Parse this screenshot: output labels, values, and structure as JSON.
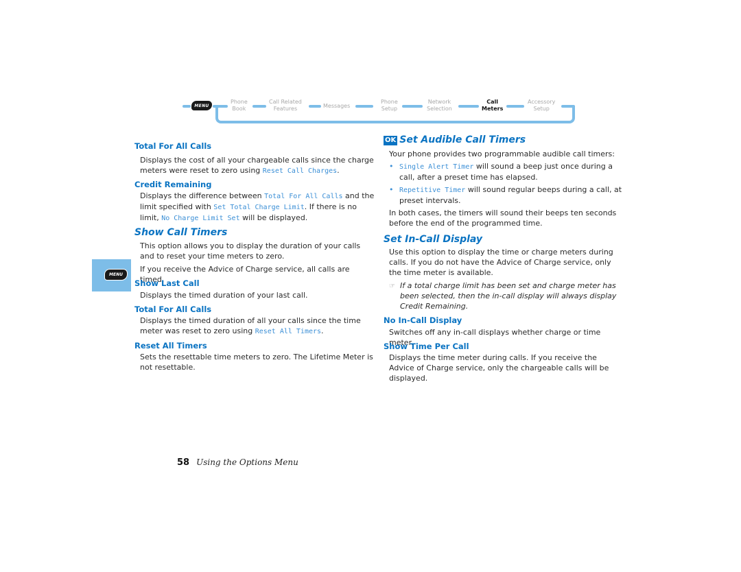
{
  "nav": {
    "menu_key": "MENU",
    "items": [
      {
        "line1": "Phone",
        "line2": "Book"
      },
      {
        "line1": "Call Related",
        "line2": "Features"
      },
      {
        "line1": "Messages",
        "line2": ""
      },
      {
        "line1": "Phone",
        "line2": "Setup"
      },
      {
        "line1": "Network",
        "line2": "Selection"
      },
      {
        "line1": "Call",
        "line2": "Meters"
      },
      {
        "line1": "Accessory",
        "line2": "Setup"
      }
    ],
    "active_index": 5
  },
  "side_tab": {
    "menu_key": "MENU"
  },
  "left": {
    "s1": {
      "heading": "Total For All Calls",
      "text_a": "Displays the cost of all your chargeable calls since the charge meters were reset to zero using ",
      "code_a": "Reset Call Charges",
      "text_b": "."
    },
    "s2": {
      "heading": "Credit Remaining",
      "text_a": "Displays the difference between ",
      "code_a": "Total For All Calls",
      "text_b": " and the limit specified with ",
      "code_b": "Set Total Charge Limit",
      "text_c": ". If there is no limit, ",
      "code_c": "No Charge Limit Set",
      "text_d": " will be displayed."
    },
    "s3": {
      "heading": "Show Call Timers",
      "p1": "This option allows you to display the duration of your calls and to reset your time meters to zero.",
      "p2": "If you receive the Advice of Charge service, all calls are timed."
    },
    "s4": {
      "heading": "Show Last Call",
      "text": "Displays the timed duration of your last call."
    },
    "s5": {
      "heading": "Total For All Calls",
      "text_a": "Displays the timed duration of all your calls since the time meter was reset to zero using ",
      "code_a": "Reset All Timers",
      "text_b": "."
    },
    "s6": {
      "heading": "Reset All Timers",
      "text": "Sets the resettable time meters to zero. The Lifetime Meter is not resettable."
    }
  },
  "right": {
    "s1": {
      "ok_icon": "OK",
      "heading": "Set Audible Call Timers",
      "intro": "Your phone provides two programmable audible call timers:",
      "bullets": [
        {
          "code": "Single Alert Timer",
          "text": " will sound a beep just once during a call, after a preset time has elapsed."
        },
        {
          "code": "Repetitive Timer",
          "text": " will sound regular beeps during a call, at preset intervals."
        }
      ],
      "outro": "In both cases, the timers will sound their beeps ten seconds before the end of the programmed time."
    },
    "s2": {
      "heading": "Set In-Call Display",
      "p1": "Use this option to display the time or charge meters during calls. If you do not have the Advice of Charge service, only the time meter is available.",
      "note": "If a total charge limit has been set and charge meter has been selected, then the in-call display will always display Credit Remaining."
    },
    "s3": {
      "heading": "No In-Call Display",
      "text": "Switches off any in-call displays whether charge or time meter."
    },
    "s4": {
      "heading": "Show Time Per Call",
      "text": "Displays the time meter during calls. If you receive the Advice of Charge service, only the chargeable calls will be displayed."
    }
  },
  "footer": {
    "page_number": "58",
    "chapter": "Using the Options Menu"
  },
  "colors": {
    "accent": "#0a73c2",
    "nav_track": "#7dbde8",
    "code_text": "#3b8fd6"
  }
}
